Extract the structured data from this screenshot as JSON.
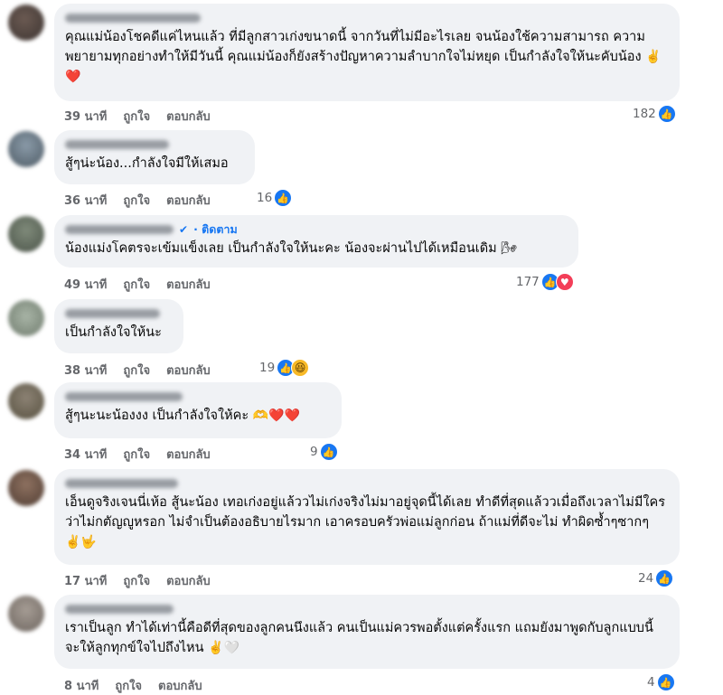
{
  "colors": {
    "bubble": "#f0f2f5",
    "meta": "#65676b",
    "link": "#1877f2",
    "like": "#1877f2",
    "love": "#f33e58"
  },
  "comments": [
    {
      "text": "คุณแม่น้องโชคดีแค่ไหนแล้ว ที่มีลูกสาวเก่งขนาดนี้ จากวันที่ไม่มีอะไรเลย จนน้องใช้ความสามารถ ความพยายามทุกอย่างทำให้มีวันนี้ คุณแม่น้องก็ยังสร้างปัญหาความลำบากใจไม่หยุด เป็นกำลังใจให้นะคับน้อง",
      "emoji": "✌️❤️",
      "time": "39 นาที",
      "like": "ถูกใจ",
      "reply": "ตอบกลับ",
      "reactions": "182",
      "reaction_icons": [
        "like-icon"
      ]
    },
    {
      "text": "สู้ๆน่ะน้อง...กำลังใจมีให้เสมอ",
      "emoji": "",
      "time": "36 นาที",
      "like": "ถูกใจ",
      "reply": "ตอบกลับ",
      "reactions": "16",
      "reaction_icons": [
        "like-icon"
      ]
    },
    {
      "text": "น้องแม่งโคตรจะเข้มแข็งเลย เป็นกำลังใจให้นะคะ น้องจะผ่านไปได้เหมือนเดิม",
      "emoji": "🌬",
      "follow": "ติดตาม",
      "time": "49 นาที",
      "like": "ถูกใจ",
      "reply": "ตอบกลับ",
      "reactions": "177",
      "reaction_icons": [
        "like-icon",
        "love-icon"
      ]
    },
    {
      "text": "เป็นกำลังใจให้นะ",
      "emoji": "",
      "time": "38 นาที",
      "like": "ถูกใจ",
      "reply": "ตอบกลับ",
      "reactions": "19",
      "reaction_icons": [
        "like-icon",
        "haha-icon"
      ]
    },
    {
      "text": "สู้ๆนะนะน้องงง เป็นกำลังใจให้คะ",
      "emoji": "🫶❤️❤️",
      "time": "34 นาที",
      "like": "ถูกใจ",
      "reply": "ตอบกลับ",
      "reactions": "9",
      "reaction_icons": [
        "like-icon"
      ]
    },
    {
      "text": "เอ็นดูจริงเจนนี่เห้อ สู้นะน้อง เทอเก่งอยู่แล้ววไม่เก่งจริงไม่มาอยู่จุดนี้ได้เลย ทำดีที่สุดแล้ววเมื่อถึงเวลาไม่มีใครว่าไม่กตัญญูหรอก ไม่จำเป็นต้องอธิบายไรมาก เอาครอบครัวพ่อแม่ลูกก่อน ถ้าแม่ที่ดีจะไม่ ทำผิดซ้ำๆซากๆ",
      "emoji": "✌️🤟",
      "time": "17 นาที",
      "like": "ถูกใจ",
      "reply": "ตอบกลับ",
      "reactions": "24",
      "reaction_icons": [
        "like-icon"
      ]
    },
    {
      "text": "เราเป็นลูก ทำได้เท่านี้คือดีที่สุดของลูกคนนึงแล้ว คนเป็นแม่ควรพอตั้งแต่ครั้งแรก แถมยังมาพูดกับลูกแบบนี้ จะให้ลูกทุกข์ใจไปถึงไหน",
      "emoji": "✌️🤍",
      "time": "8 นาที",
      "like": "ถูกใจ",
      "reply": "ตอบกลับ",
      "reactions": "4",
      "reaction_icons": [
        "like-icon"
      ]
    }
  ]
}
